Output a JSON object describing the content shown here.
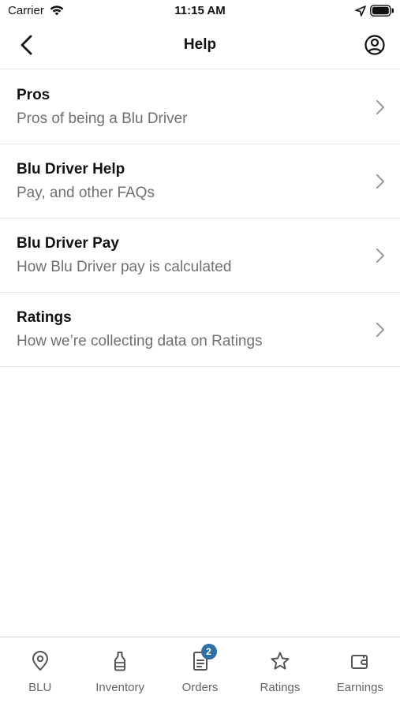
{
  "status_bar": {
    "carrier": "Carrier",
    "time": "11:15 AM"
  },
  "nav": {
    "title": "Help",
    "back_icon": "chevron-left-icon",
    "profile_icon": "user-circle-icon"
  },
  "help_items": [
    {
      "title": "Pros",
      "subtitle": "Pros of being a Blu Driver"
    },
    {
      "title": "Blu Driver Help",
      "subtitle": "Pay, and other FAQs"
    },
    {
      "title": "Blu Driver Pay",
      "subtitle": "How Blu Driver pay is calculated"
    },
    {
      "title": "Ratings",
      "subtitle": "How we’re collecting data on Ratings"
    }
  ],
  "tab_bar": {
    "tabs": [
      {
        "label": "BLU",
        "icon": "location-pin-icon"
      },
      {
        "label": "Inventory",
        "icon": "bottle-icon"
      },
      {
        "label": "Orders",
        "icon": "document-icon",
        "badge": "2"
      },
      {
        "label": "Ratings",
        "icon": "star-icon"
      },
      {
        "label": "Earnings",
        "icon": "wallet-icon"
      }
    ]
  },
  "colors": {
    "badge": "#2f6fa8",
    "subtitle": "#707070",
    "divider": "#e3e3e3"
  }
}
